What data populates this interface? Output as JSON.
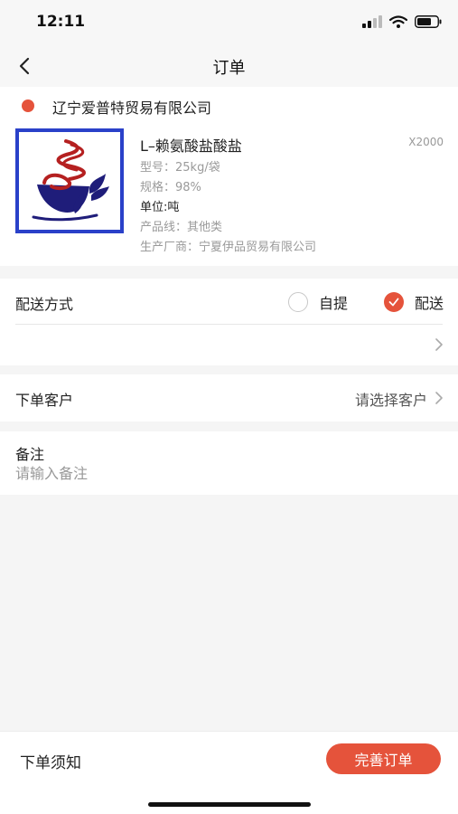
{
  "status_bar": {
    "time": "12:11"
  },
  "nav": {
    "title": "订单"
  },
  "store": {
    "name": "辽宁爱普特贸易有限公司"
  },
  "product": {
    "name": "L–赖氨酸盐酸盐",
    "quantity": "X2000",
    "model": "型号：25kg/袋",
    "spec": "规格：98%",
    "unit": "单位:吨",
    "product_line": "产品线：其他类",
    "manufacturer": "生产厂商：宁夏伊品贸易有限公司"
  },
  "delivery": {
    "label": "配送方式",
    "options": [
      {
        "label": "自提",
        "selected": false
      },
      {
        "label": "配送",
        "selected": true
      }
    ]
  },
  "customer": {
    "label": "下单客户",
    "value": "请选择客户"
  },
  "remark": {
    "label": "备注",
    "placeholder": "请输入备注"
  },
  "bottom": {
    "notice": "下单须知",
    "submit": "完善订单"
  },
  "colors": {
    "accent": "#e5533b",
    "image_border": "#2a41c9"
  }
}
